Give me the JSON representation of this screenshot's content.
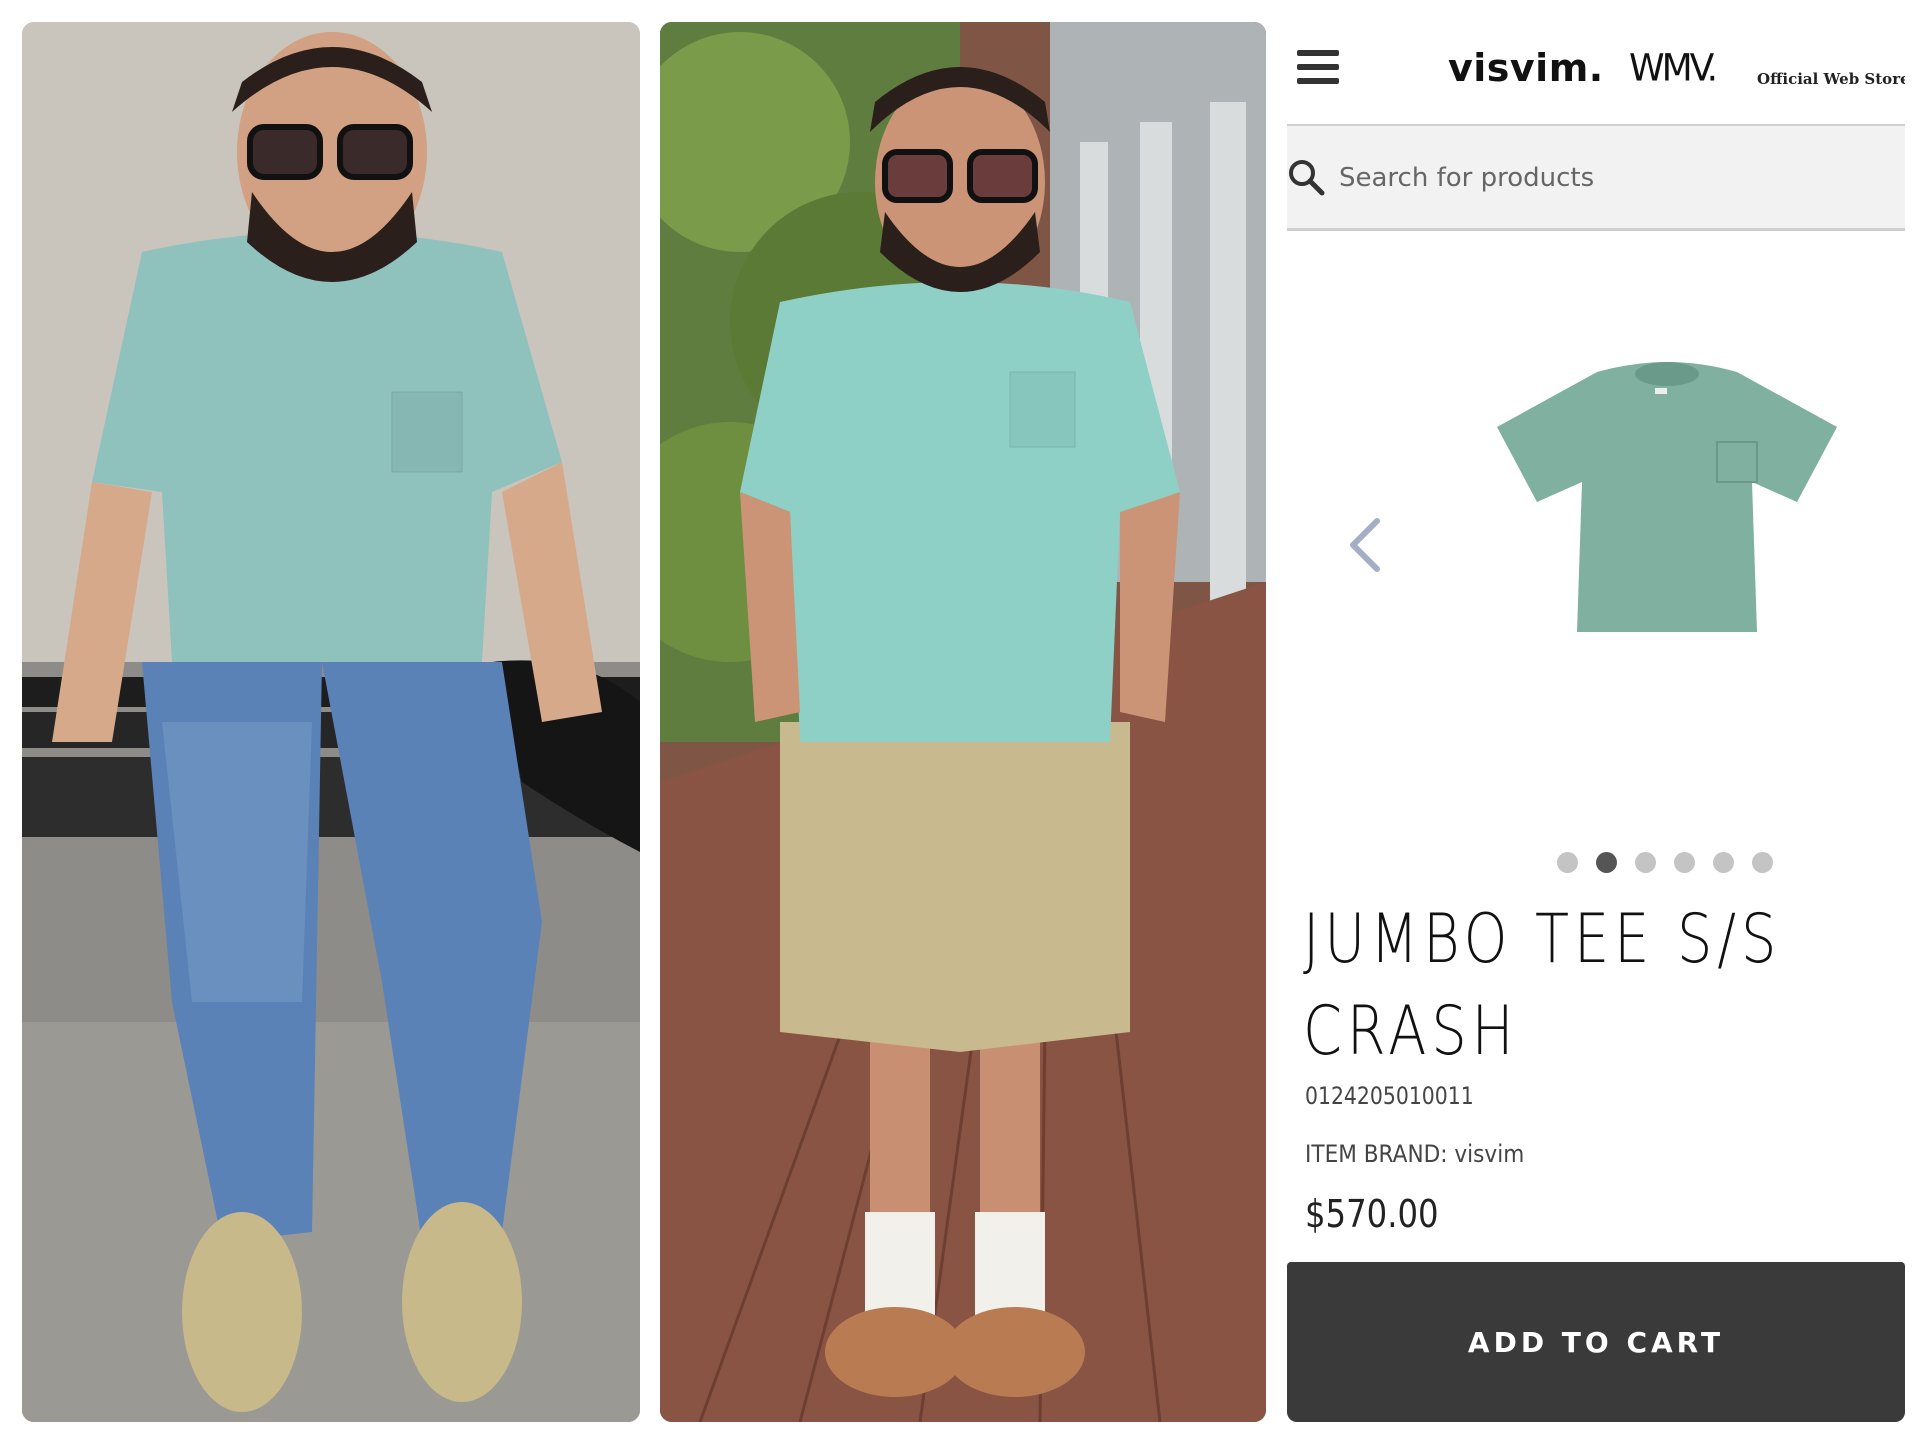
{
  "photos": [
    {
      "description_icon": "person-sitting-photo"
    },
    {
      "description_icon": "person-standing-photo"
    }
  ],
  "store": {
    "menu_icon": "hamburger-menu-icon",
    "logo_primary": "visvim.",
    "logo_secondary": "WMV.",
    "store_label": "Official Web Store",
    "search": {
      "placeholder": "Search for products",
      "icon": "search-icon"
    },
    "carousel": {
      "prev_icon": "chevron-left-icon",
      "dot_count": 6,
      "active_index": 1
    },
    "product": {
      "title_line1": "JUMBO TEE S/S",
      "title_line2": "CRASH",
      "sku": "0124205010011",
      "brand_line": "ITEM BRAND: visvim",
      "price": "$570.00",
      "shirt_color": "#7fb0a0"
    },
    "add_to_cart_label": "ADD TO CART"
  }
}
